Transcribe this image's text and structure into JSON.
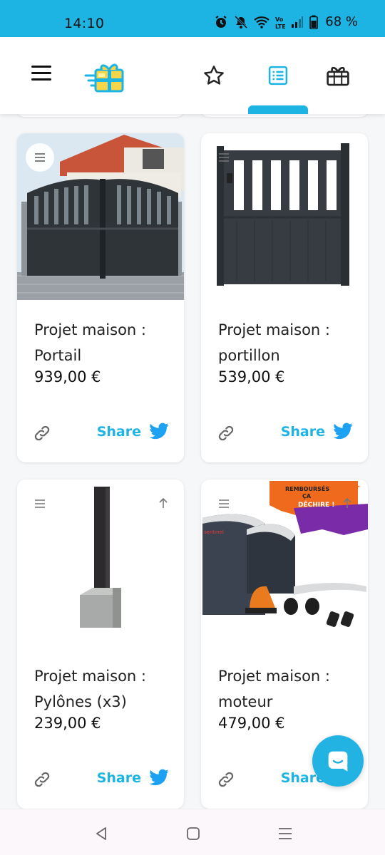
{
  "status_bar": {
    "time": "14:10",
    "battery": "68 %",
    "icons": [
      "alarm-icon",
      "mute-icon",
      "wifi-icon",
      "volte-icon",
      "signal-icon",
      "battery-icon"
    ]
  },
  "header": {
    "menu_icon": "hamburger-icon",
    "logo_icon": "gift-box-logo",
    "nav": [
      {
        "icon": "star-icon",
        "active": false
      },
      {
        "icon": "list-icon",
        "active": true
      },
      {
        "icon": "gift-icon",
        "active": false
      }
    ],
    "accent_color": "#1db4e4"
  },
  "cards": [
    {
      "title_line1": "Projet maison :",
      "title_line2": "Portail",
      "price": "939,00 €",
      "share_label": "Share"
    },
    {
      "title_line1": "Projet maison :",
      "title_line2": "portillon",
      "price": "539,00 €",
      "share_label": "Share"
    },
    {
      "title_line1": "Projet maison :",
      "title_line2": "Pylônes (x3)",
      "price": "239,00 €",
      "share_label": "Share"
    },
    {
      "title_line1": "Projet maison :",
      "title_line2": "moteur",
      "price": "479,00 €",
      "share_label": "Share",
      "image_text": {
        "promo": "REMBOURSÉS",
        "promo2": "ÇA",
        "promo3": "DÉCHIRE !",
        "brand": "sentinel",
        "plus": "+"
      }
    }
  ],
  "chat_icon": "chat-bubble-icon",
  "system_nav": [
    "back-icon",
    "home-icon",
    "recents-icon"
  ]
}
